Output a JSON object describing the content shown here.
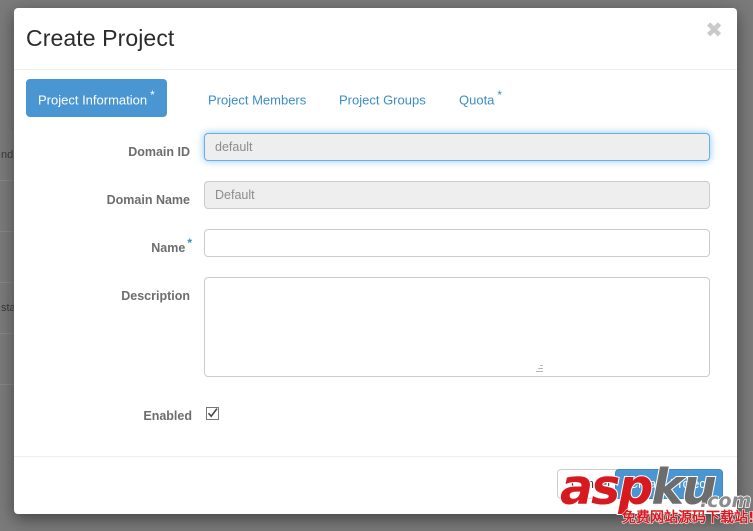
{
  "modal": {
    "title": "Create Project",
    "close_icon": "close-icon",
    "close_glyph": "✖"
  },
  "tabs": [
    {
      "label": "Project Information",
      "required": "*",
      "active": true,
      "name": "tab-project-information"
    },
    {
      "label": "Project Members",
      "required": "",
      "active": false,
      "name": "tab-project-members"
    },
    {
      "label": "Project Groups",
      "required": "",
      "active": false,
      "name": "tab-project-groups"
    },
    {
      "label": "Quota",
      "required": "*",
      "active": false,
      "name": "tab-quota"
    }
  ],
  "form": {
    "domain_id": {
      "label": "Domain ID",
      "required": "",
      "value": "default",
      "placeholder": "",
      "disabled": true,
      "focused": true
    },
    "domain_name": {
      "label": "Domain Name",
      "required": "",
      "value": "Default",
      "placeholder": "",
      "disabled": true,
      "focused": false
    },
    "name": {
      "label": "Name",
      "required": "*",
      "value": "",
      "placeholder": "",
      "disabled": false,
      "focused": false
    },
    "description": {
      "label": "Description",
      "required": "",
      "value": "",
      "placeholder": "",
      "disabled": false,
      "focused": false
    },
    "enabled": {
      "label": "Enabled",
      "checked": true
    }
  },
  "footer": {
    "cancel_label": "Cancel",
    "submit_label": "Create Project"
  },
  "backdrop": {
    "rows": [
      "nd",
      "",
      "",
      "sta",
      ""
    ]
  },
  "watermark": {
    "brand_a": "asp",
    "brand_b": "ku",
    "tld": ".com",
    "tagline": "免费网站源码下载站!"
  },
  "colors": {
    "accent": "#4a96d2",
    "link": "#3c8dc5",
    "focus_ring": "#66afe9",
    "label": "#6d6d6d",
    "watermark_red": "#d71920"
  }
}
